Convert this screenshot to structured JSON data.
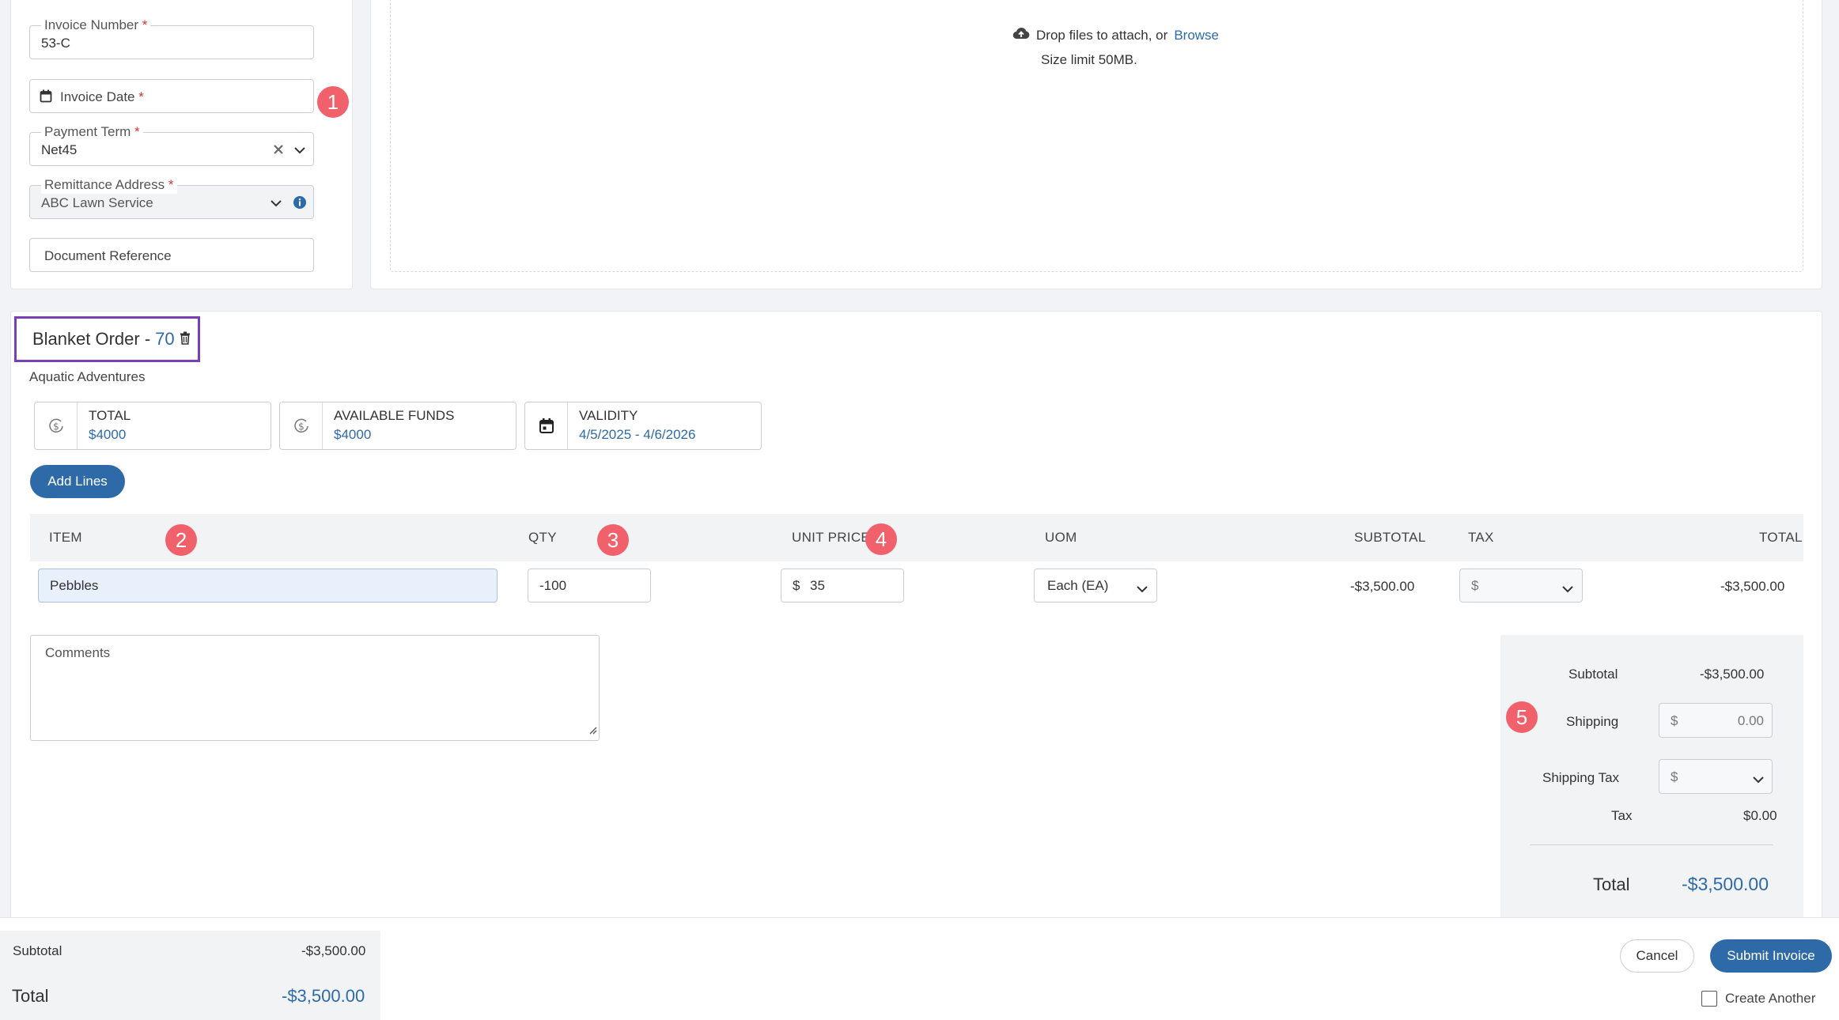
{
  "form": {
    "invoice_number": {
      "label": "Invoice Number",
      "required_mark": "*",
      "value": "53-C"
    },
    "invoice_date": {
      "label": "Invoice Date",
      "required_mark": "*"
    },
    "payment_term": {
      "label": "Payment Term",
      "required_mark": "*",
      "value": "Net45"
    },
    "remittance_address": {
      "label": "Remittance Address",
      "required_mark": "*",
      "value": "ABC Lawn Service"
    },
    "document_reference": {
      "placeholder": "Document Reference"
    }
  },
  "upload": {
    "drop_text": "Drop files to attach, or",
    "browse_link": "Browse",
    "size_limit": "Size limit 50MB."
  },
  "badges": [
    "1",
    "2",
    "3",
    "4",
    "5"
  ],
  "blanket_order": {
    "title": "Blanket Order -",
    "number": "70",
    "vendor": "Aquatic Adventures",
    "stats": [
      {
        "label": "TOTAL",
        "value": "$4000",
        "icon": "dollar-coin-icon"
      },
      {
        "label": "AVAILABLE FUNDS",
        "value": "$4000",
        "icon": "dollar-coin-icon"
      },
      {
        "label": "VALIDITY",
        "value": "4/5/2025 - 4/6/2026",
        "icon": "calendar-icon"
      }
    ],
    "add_lines_label": "Add Lines"
  },
  "table": {
    "headers": {
      "item": "ITEM",
      "qty": "QTY",
      "unit_price": "UNIT PRICE",
      "uom": "UOM",
      "subtotal": "SUBTOTAL",
      "tax": "TAX",
      "total": "TOTAL"
    },
    "row": {
      "item": "Pebbles",
      "qty": "-100",
      "currency": "$",
      "unit_price": "35",
      "uom": "Each (EA)",
      "subtotal": "-$3,500.00",
      "tax_currency": "$",
      "total": "-$3,500.00"
    }
  },
  "comments_placeholder": "Comments",
  "totals": {
    "subtotal_label": "Subtotal",
    "subtotal_value": "-$3,500.00",
    "shipping_label": "Shipping",
    "shipping_currency": "$",
    "shipping_value": "0.00",
    "shipping_tax_label": "Shipping Tax",
    "shipping_tax_currency": "$",
    "tax_label": "Tax",
    "tax_value": "$0.00",
    "total_label": "Total",
    "total_value": "-$3,500.00"
  },
  "footer": {
    "subtotal_label": "Subtotal",
    "subtotal_value": "-$3,500.00",
    "total_label": "Total",
    "total_value": "-$3,500.00",
    "cancel_label": "Cancel",
    "submit_label": "Submit Invoice",
    "create_another_label": "Create Another"
  },
  "colors": {
    "accent": "#2e6aa8",
    "badge": "#f0616c",
    "highlight_border": "#7b3fb5",
    "required": "#d9313c"
  }
}
